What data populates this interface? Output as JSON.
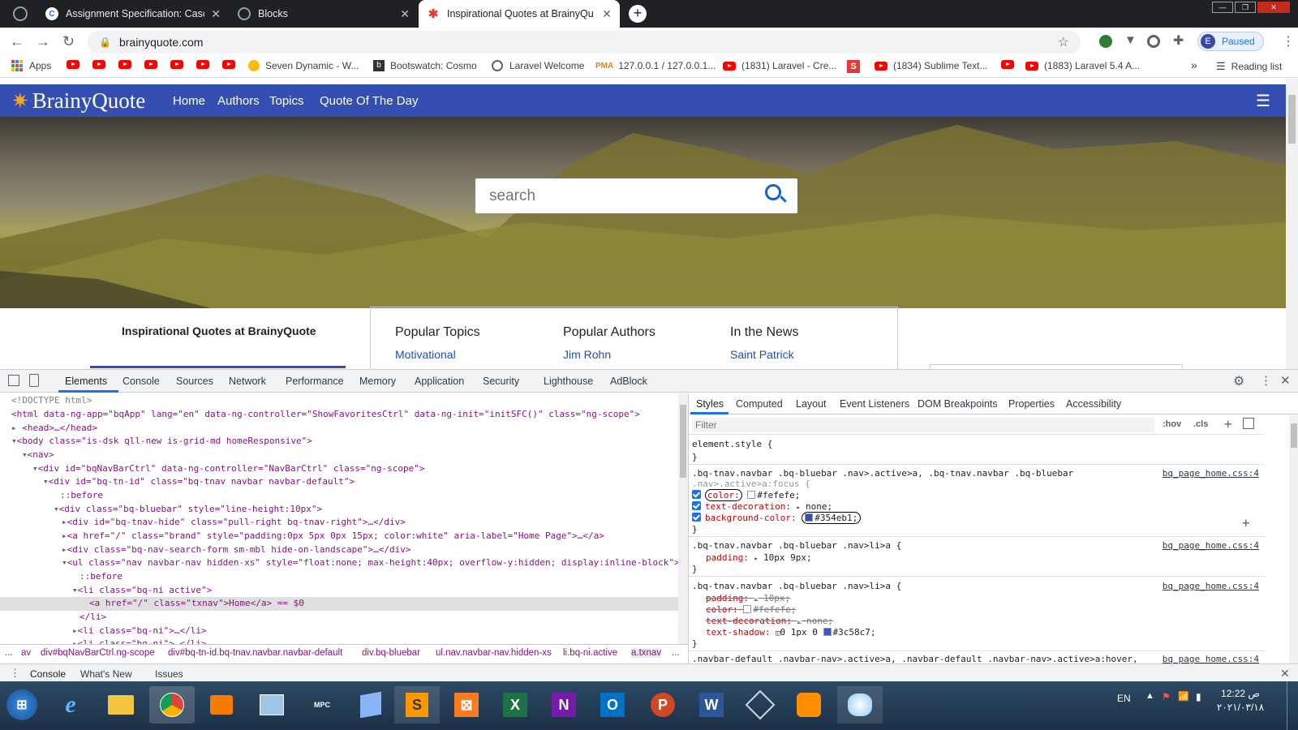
{
  "browser": {
    "tabs": [
      {
        "title": "",
        "favicon": "chrome-icon"
      },
      {
        "title": "Assignment Specification: Cascac",
        "favicon": "c-logo-icon"
      },
      {
        "title": "Blocks",
        "favicon": "globe-icon"
      },
      {
        "title": "Inspirational Quotes at BrainyQu",
        "favicon": "brainyquote-icon",
        "active": true
      }
    ],
    "url": "brainyquote.com",
    "profile_initial": "E",
    "profile_status": "Paused",
    "bookmarks": {
      "apps": "Apps",
      "items": [
        "Seven Dynamic - W...",
        "Bootswatch: Cosmo",
        "Laravel Welcome",
        "127.0.0.1 / 127.0.0.1...",
        "(1831) Laravel - Cre...",
        "(1834) Sublime Text...",
        "(1883) Laravel 5.4 A..."
      ],
      "overflow": "»",
      "reading_list": "Reading list"
    }
  },
  "site": {
    "brand": "BrainyQuote",
    "nav": [
      "Home",
      "Authors",
      "Topics",
      "Quote Of The Day"
    ],
    "search_placeholder": "search",
    "tagline": "Inspirational Quotes at BrainyQuote",
    "columns": [
      {
        "heading": "Popular Topics",
        "first": "Motivational"
      },
      {
        "heading": "Popular Authors",
        "first": "Jim Rohn"
      },
      {
        "heading": "In the News",
        "first": "Saint Patrick"
      }
    ]
  },
  "devtools": {
    "tabs": [
      "Elements",
      "Console",
      "Sources",
      "Network",
      "Performance",
      "Memory",
      "Application",
      "Security",
      "Lighthouse",
      "AdBlock"
    ],
    "active_tab": "Elements",
    "dom_lines": [
      "<!DOCTYPE html>",
      "<html data-ng-app=\"bqApp\" lang=\"en\" data-ng-controller=\"ShowFavoritesCtrl\" data-ng-init=\"initSFC()\" class=\"ng-scope\">",
      "<head>…</head>",
      "<body class=\"is-dsk qll-new is-grid-md homeResponsive\">",
      "<nav>",
      "<div id=\"bqNavBarCtrl\" data-ng-controller=\"NavBarCtrl\" class=\"ng-scope\">",
      "<div id=\"bq-tn-id\" class=\"bq-tnav navbar navbar-default\">",
      "::before",
      "<div class=\"bq-bluebar\" style=\"line-height:10px\">",
      "<div id=\"bq-tnav-hide\" class=\"pull-right bq-tnav-right\">…</div>",
      "<a href=\"/\" class=\"brand\" style=\"padding:0px 5px 0px 15px; color:white\" aria-label=\"Home Page\">…</a>",
      "<div class=\"bq-nav-search-form sm-mbl hide-on-landscape\">…</div>",
      "<ul class=\"nav navbar-nav hidden-xs\" style=\"float:none; max-height:40px; overflow-y:hidden; display:inline-block\">",
      "::before",
      "<li class=\"bq-ni active\">",
      "<a href=\"/\" class=\"txnav\">Home</a> == $0",
      "</li>",
      "<li class=\"bq-ni\">…</li>",
      "<li class=\"bq-ni\">…</li>"
    ],
    "breadcrumbs": [
      "...",
      "av",
      "div#bqNavBarCtrl.ng-scope",
      "div#bq-tn-id.bq-tnav.navbar.navbar-default",
      "div.bq-bluebar",
      "ul.nav.navbar-nav.hidden-xs",
      "li.bq-ni.active",
      "a.txnav",
      "..."
    ],
    "styles_tabs": [
      "Styles",
      "Computed",
      "Layout",
      "Event Listeners",
      "DOM Breakpoints",
      "Properties",
      "Accessibility"
    ],
    "filter_placeholder": "Filter",
    "hov": ":hov",
    "cls": ".cls",
    "element_style": "element.style {",
    "rule1_selector": ".bq-tnav.navbar .bq-bluebar .nav>.active>a, .bq-tnav.navbar .bq-bluebar",
    "rule1_selector2": ".nav>.active>a:focus {",
    "rule1_source": "bq_page_home.css:4",
    "rule1_props": [
      {
        "name": "color:",
        "value": "#fefefe;",
        "swatch": "#fefefe"
      },
      {
        "name": "text-decoration:",
        "value": "none;"
      },
      {
        "name": "background-color:",
        "value": "#354eb1;",
        "swatch": "#354eb1"
      }
    ],
    "rule2_selector": ".bq-tnav.navbar .bq-bluebar .nav>li>a {",
    "rule2_source": "bq_page_home.css:4",
    "rule2_prop": "padding:",
    "rule2_value": "10px 9px;",
    "rule3_selector": ".bq-tnav.navbar .bq-bluebar .nav>li>a {",
    "rule3_source": "bq_page_home.css:4",
    "rule3_props": [
      {
        "name": "padding:",
        "value": "10px;"
      },
      {
        "name": "color:",
        "value": "#fefefe;"
      },
      {
        "name": "text-decoration:",
        "value": "none;"
      }
    ],
    "rule3_shadow_name": "text-shadow:",
    "rule3_shadow_value": "0 1px 0",
    "rule3_shadow_color": "#3c58c7;",
    "rule4_selector": ".navbar-default .navbar-nav>.active>a, .navbar-default .navbar-nav>.active>a:hover,",
    "rule4_source": "bq_page_home.css:4",
    "drawer_tabs": [
      "Console",
      "What's New",
      "Issues"
    ]
  },
  "taskbar": {
    "lang": "EN",
    "time": "12:22 ص",
    "date": "٢٠٢١/٠٣/١٨"
  },
  "colors": {
    "bq_blue": "#354eb1",
    "chrome_dark": "#202124"
  }
}
